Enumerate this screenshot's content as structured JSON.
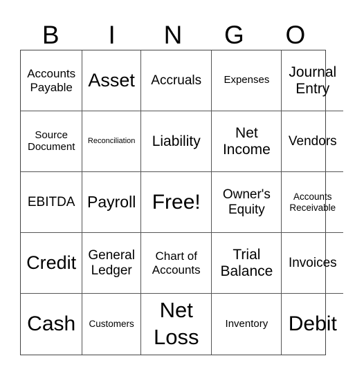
{
  "header": [
    "B",
    "I",
    "N",
    "G",
    "O"
  ],
  "cells": [
    "Accounts Payable",
    "Asset",
    "Accruals",
    "Expenses",
    "Journal Entry",
    "Source Document",
    "Reconciliation",
    "Liability",
    "Net Income",
    "Vendors",
    "EBITDA",
    "Payroll",
    "Free!",
    "Owner's Equity",
    "Accounts Receivable",
    "Credit",
    "General Ledger",
    "Chart of Accounts",
    "Trial Balance",
    "Invoices",
    "Cash",
    "Customers",
    "Net Loss",
    "Inventory",
    "Debit"
  ]
}
